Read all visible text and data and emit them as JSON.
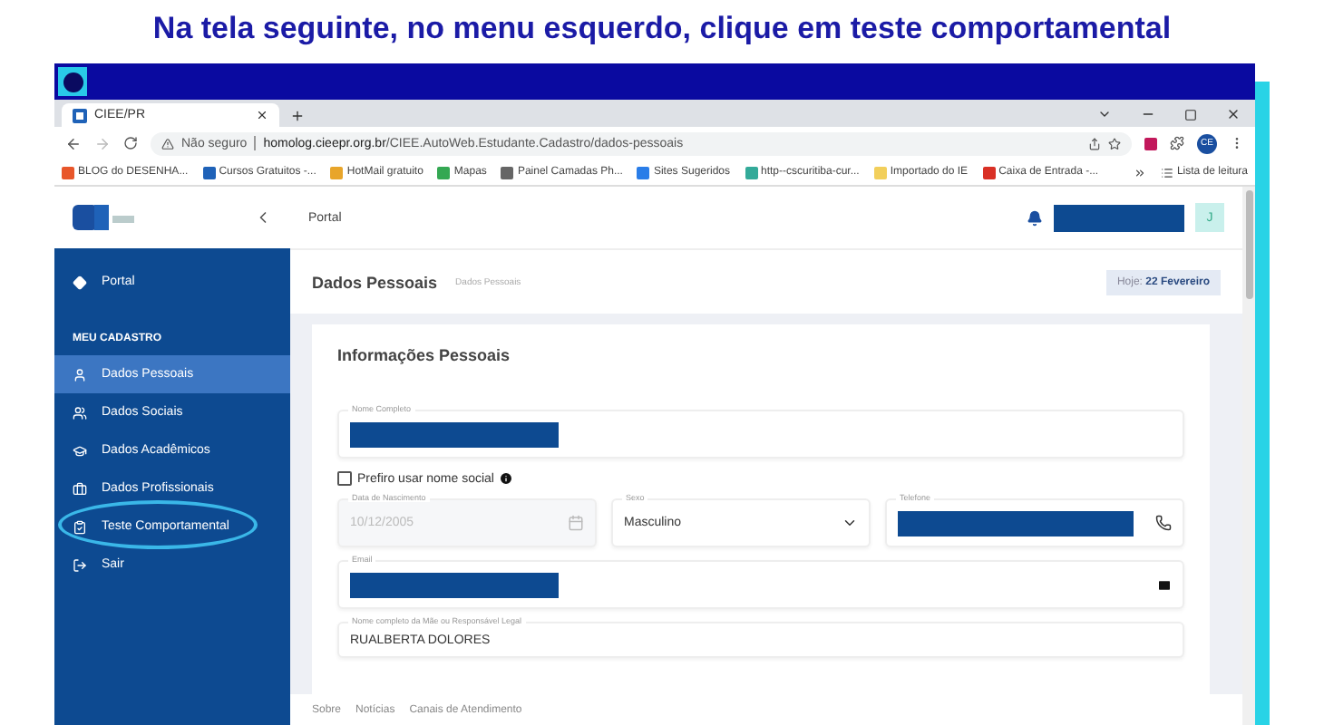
{
  "headline": "Na tela seguinte, no menu esquerdo, clique em teste comportamental",
  "browser": {
    "tab_title": "CIEE/PR",
    "security": "Não seguro",
    "url_host": "homolog.cieepr.org.br",
    "url_path": "/CIEE.AutoWeb.Estudante.Cadastro/dados-pessoais",
    "profile": "CE",
    "bookmarks": [
      "BLOG do DESENHA...",
      "Cursos Gratuitos -...",
      "HotMail gratuito",
      "Mapas",
      "Painel Camadas Ph...",
      "Sites Sugeridos",
      "http--cscuritiba-cur...",
      "Importado do IE",
      "Caixa de Entrada -..."
    ],
    "reading_list": "Lista de leitura"
  },
  "header": {
    "breadcrumb": "Portal",
    "avatar": "J"
  },
  "sidebar": {
    "portal": "Portal",
    "section": "MEU CADASTRO",
    "items": [
      {
        "label": "Dados Pessoais",
        "selected": true,
        "circled": false
      },
      {
        "label": "Dados Sociais",
        "selected": false,
        "circled": false
      },
      {
        "label": "Dados Acadêmicos",
        "selected": false,
        "circled": false
      },
      {
        "label": "Dados Profissionais",
        "selected": false,
        "circled": false
      },
      {
        "label": "Teste Comportamental",
        "selected": false,
        "circled": true
      },
      {
        "label": "Sair",
        "selected": false,
        "circled": false
      }
    ]
  },
  "page": {
    "title": "Dados Pessoais",
    "crumb": "Dados Pessoais",
    "date_label": "Hoje:",
    "date": "22 Fevereiro"
  },
  "card": {
    "title": "Informações Pessoais",
    "name_field": {
      "label": "Nome Completo",
      "redacted": true
    },
    "social_name": {
      "label": "Prefiro usar nome social",
      "checked": false
    },
    "row_fields": [
      {
        "kind": "date",
        "label": "Data de Nascimento",
        "value": "10/12/2005",
        "disabled": true,
        "redacted": false
      },
      {
        "kind": "select",
        "label": "Sexo",
        "value": "Masculino",
        "disabled": false,
        "redacted": false
      },
      {
        "kind": "phone",
        "label": "Telefone",
        "disabled": false,
        "redacted": true
      }
    ],
    "email_field": {
      "label": "Email",
      "redacted": true
    },
    "mother_field": {
      "label": "Nome completo da Mãe ou Responsável Legal",
      "value": "RUALBERTA DOLORES"
    }
  },
  "footer": [
    "Sobre",
    "Notícias",
    "Canais de Atendimento"
  ]
}
